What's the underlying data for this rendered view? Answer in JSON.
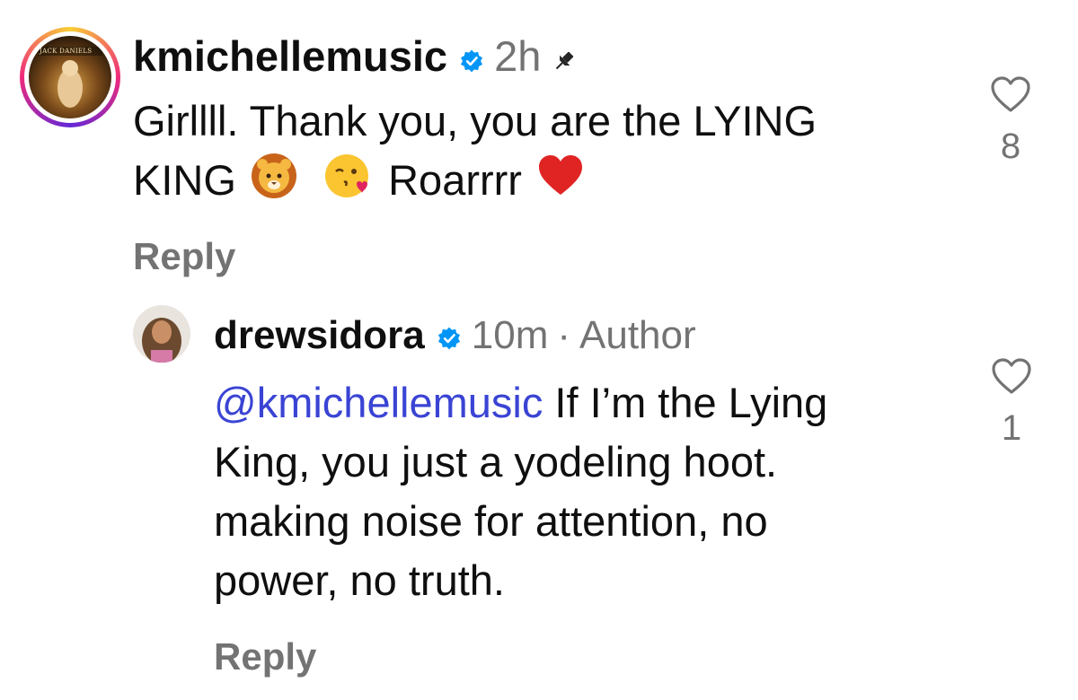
{
  "comments": [
    {
      "username": "kmichellemusic",
      "time": "2h",
      "text_part1": "Girllll. Thank you, you are the LYING",
      "text_part2_a": "KING",
      "text_part2_b": " Roarrrr",
      "likes": "8",
      "reply_label": "Reply",
      "avatar_text": "JACK DANIELS"
    },
    {
      "username": "drewsidora",
      "time": "10m",
      "separator": "·",
      "author_label": "Author",
      "mention": "@kmichellemusic",
      "text_line1": " If I’m the Lying",
      "text_line2": "King, you just a yodeling hoot.",
      "text_line3": "making noise for attention, no",
      "text_line4": "power, no truth.",
      "likes": "1",
      "reply_label": "Reply"
    }
  ],
  "icons": {
    "verified": "verified-badge-icon",
    "pin": "pin-icon",
    "heart": "heart-outline-icon",
    "lion": "lion-face-emoji",
    "kiss": "face-blowing-kiss-emoji",
    "red_heart": "red-heart-emoji"
  },
  "colors": {
    "verified_blue": "#0095f6",
    "mention_blue": "#3a44d4",
    "meta_gray": "#737373",
    "heart_red": "#e02424"
  }
}
